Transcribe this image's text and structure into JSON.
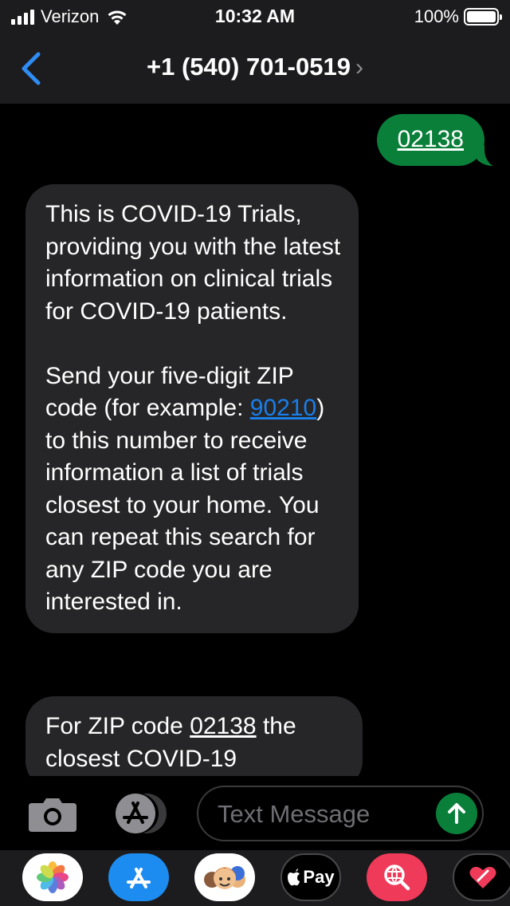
{
  "status_bar": {
    "carrier": "Verizon",
    "time": "10:32 AM",
    "battery_percent": "100%",
    "signal_icon": "cellular-signal-icon",
    "wifi_icon": "wifi-icon",
    "battery_icon": "battery-icon"
  },
  "header": {
    "contact": "+1 (540) 701-0519",
    "chevron": "›",
    "back_icon": "chevron-left-icon"
  },
  "messages": {
    "sent_1": "02138",
    "received_1": {
      "p1": "This is COVID-19 Trials, providing you with the latest information on clinical trials for COVID-19 patients.",
      "p2_before": "Send your five-digit ZIP code (for example: ",
      "p2_link": "90210",
      "p2_after": ") to this number to receive information a list of trials closest to your home. You can repeat this search for any ZIP code you are interested in."
    },
    "received_2": {
      "before": "For ZIP code ",
      "link": "02138",
      "after": " the closest COVID-19"
    }
  },
  "composer": {
    "placeholder": "Text Message",
    "camera_icon": "camera-icon",
    "apps_icon": "app-store-icon",
    "send_icon": "arrow-up-icon"
  },
  "app_drawer": {
    "pay_label": "Pay",
    "apps": [
      "photos-icon",
      "app-store-icon",
      "memoji-icon",
      "apple-pay-icon",
      "web-search-icon",
      "digital-touch-icon"
    ]
  },
  "colors": {
    "sent_bubble": "#0a7f3a",
    "received_bubble": "#262628",
    "link": "#1a7ee8",
    "accent_blue": "#1d8cf0",
    "background": "#000000"
  }
}
